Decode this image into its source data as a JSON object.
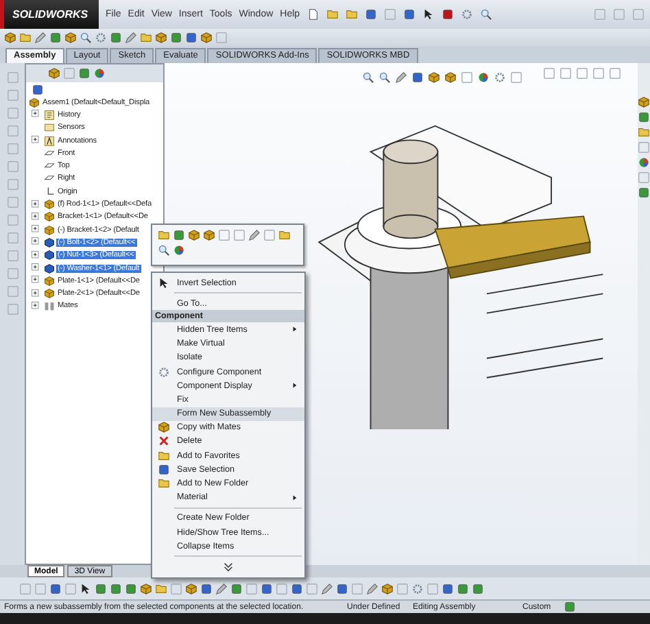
{
  "app": {
    "logo": "SOLIDWORKS",
    "menus": [
      "File",
      "Edit",
      "View",
      "Insert",
      "Tools",
      "Window",
      "Help"
    ]
  },
  "tabs": [
    {
      "label": "Assembly",
      "selected": true
    },
    {
      "label": "Layout",
      "selected": false
    },
    {
      "label": "Sketch",
      "selected": false
    },
    {
      "label": "Evaluate",
      "selected": false
    },
    {
      "label": "SOLIDWORKS Add-Ins",
      "selected": false
    },
    {
      "label": "SOLIDWORKS MBD",
      "selected": false
    }
  ],
  "tree": {
    "label": "Assem1 (Default<Default_Displa",
    "children": [
      {
        "label": "History",
        "kind": "history",
        "expanded": false,
        "selected": false
      },
      {
        "label": "Sensors",
        "kind": "sensor",
        "selected": false
      },
      {
        "label": "Annotations",
        "kind": "annotation",
        "expanded": false,
        "selected": false
      },
      {
        "label": "Front",
        "kind": "plane",
        "selected": false
      },
      {
        "label": "Top",
        "kind": "plane",
        "selected": false
      },
      {
        "label": "Right",
        "kind": "plane",
        "selected": false
      },
      {
        "label": "Origin",
        "kind": "origin",
        "selected": false
      },
      {
        "label": "(f) Rod-1<1> (Default<<Defa",
        "kind": "part",
        "expanded": false,
        "selected": false
      },
      {
        "label": "Bracket-1<1> (Default<<De",
        "kind": "part",
        "expanded": false,
        "selected": false
      },
      {
        "label": "(-) Bracket-1<2> (Default",
        "kind": "part",
        "expanded": false,
        "selected": false
      },
      {
        "label": "(-) Bolt-1<2> (Default<<",
        "kind": "part",
        "expanded": false,
        "selected": true
      },
      {
        "label": "(-) Nut-1<3> (Default<<",
        "kind": "part",
        "expanded": false,
        "selected": true
      },
      {
        "label": "(-) Washer-1<1> (Default",
        "kind": "part",
        "expanded": false,
        "selected": true
      },
      {
        "label": "Plate-1<1> (Default<<De",
        "kind": "part",
        "expanded": false,
        "selected": false
      },
      {
        "label": "Plate-2<1> (Default<<De",
        "kind": "part",
        "expanded": false,
        "selected": false
      },
      {
        "label": "Mates",
        "kind": "mates",
        "expanded": false,
        "selected": false
      }
    ]
  },
  "context_menu": [
    {
      "kind": "item",
      "label": "Invert Selection",
      "submenu": false,
      "highlighted": false
    },
    {
      "kind": "separator"
    },
    {
      "kind": "item",
      "label": "Go To...",
      "submenu": false,
      "highlighted": false
    },
    {
      "kind": "header",
      "label": "Component"
    },
    {
      "kind": "item",
      "label": "Hidden Tree Items",
      "submenu": true,
      "highlighted": false
    },
    {
      "kind": "item",
      "label": "Make Virtual",
      "submenu": false,
      "highlighted": false
    },
    {
      "kind": "item",
      "label": "Isolate",
      "submenu": false,
      "highlighted": false
    },
    {
      "kind": "item",
      "label": "Configure Component",
      "submenu": false,
      "highlighted": false
    },
    {
      "kind": "item",
      "label": "Component Display",
      "submenu": true,
      "highlighted": false
    },
    {
      "kind": "item",
      "label": "Fix",
      "submenu": false,
      "highlighted": false
    },
    {
      "kind": "item",
      "label": "Form New Subassembly",
      "submenu": false,
      "highlighted": true
    },
    {
      "kind": "item",
      "label": "Copy with Mates",
      "submenu": false,
      "highlighted": false
    },
    {
      "kind": "item",
      "label": "Delete",
      "submenu": false,
      "highlighted": false
    },
    {
      "kind": "item",
      "label": "Add to Favorites",
      "submenu": false,
      "highlighted": false
    },
    {
      "kind": "item",
      "label": "Save Selection",
      "submenu": false,
      "highlighted": false
    },
    {
      "kind": "item",
      "label": "Add to New Folder",
      "submenu": false,
      "highlighted": false
    },
    {
      "kind": "item",
      "label": "Material",
      "submenu": true,
      "highlighted": false
    },
    {
      "kind": "separator"
    },
    {
      "kind": "item",
      "label": "Create New Folder",
      "submenu": false,
      "highlighted": false
    },
    {
      "kind": "item",
      "label": "Hide/Show Tree Items...",
      "submenu": false,
      "highlighted": false
    },
    {
      "kind": "item",
      "label": "Collapse Items",
      "submenu": false,
      "highlighted": false
    },
    {
      "kind": "separator"
    },
    {
      "kind": "more"
    }
  ],
  "bottom_tabs": [
    {
      "label": "Model",
      "selected": true
    },
    {
      "label": "3D View",
      "selected": false
    }
  ],
  "status_bar": {
    "message": "Forms a new subassembly from the selected components at the selected location.",
    "state": "Under Defined",
    "mode": "Editing Assembly",
    "units": "Custom"
  }
}
